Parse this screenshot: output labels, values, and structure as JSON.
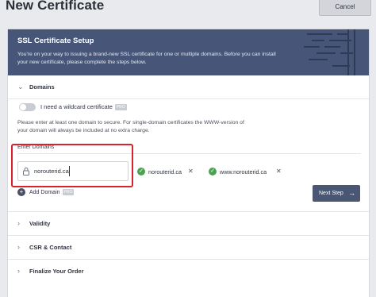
{
  "header": {
    "title": "New Certificate",
    "cancel_label": "Cancel"
  },
  "banner": {
    "title": "SSL Certificate Setup",
    "text": "You're on your way to issuing a brand-new SSL certificate for one or multiple domains. Before you can install your new certificate, please complete the steps below."
  },
  "domains": {
    "section_label": "Domains",
    "wildcard_label": "I need a wildcard certificate",
    "wildcard_badge": "PRO",
    "wildcard_enabled": false,
    "help_text": "Please enter at least one domain to secure. For single-domain certificates the WWW-version of your domain will always be included at no extra charge.",
    "enter_label": "Enter Domains",
    "input_value": "norouterid.ca",
    "added": [
      {
        "name": "norouterid.ca"
      },
      {
        "name": "www.norouterid.ca"
      }
    ],
    "add_label": "Add Domain",
    "add_badge": "PRO",
    "next_label": "Next Step"
  },
  "sections": [
    {
      "label": "Validity"
    },
    {
      "label": "CSR & Contact"
    },
    {
      "label": "Finalize Your Order"
    }
  ],
  "colors": {
    "banner": "#475678",
    "next_button": "#495774",
    "check": "#4aa351",
    "highlight": "#d8232e"
  }
}
